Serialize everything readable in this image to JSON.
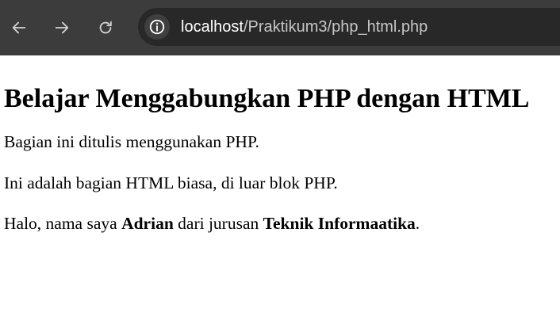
{
  "browser": {
    "url_host": "localhost",
    "url_path": "/Praktikum3/php_html.php",
    "icons": {
      "back": "arrow-left-icon",
      "forward": "arrow-right-icon",
      "reload": "reload-icon",
      "site_info": "info-icon"
    },
    "colors": {
      "toolbar_bg": "#3c3c3c",
      "omnibox_bg": "#282828"
    }
  },
  "page": {
    "heading": "Belajar Menggabungkan PHP dengan HTML",
    "paragraph_php": "Bagian ini ditulis menggunakan PHP.",
    "paragraph_html": "Ini adalah bagian HTML biasa, di luar blok PHP.",
    "intro": {
      "text1": "Halo, nama saya ",
      "name": "Adrian",
      "text2": " dari jurusan ",
      "major": "Teknik Informaatika",
      "text3": "."
    }
  }
}
